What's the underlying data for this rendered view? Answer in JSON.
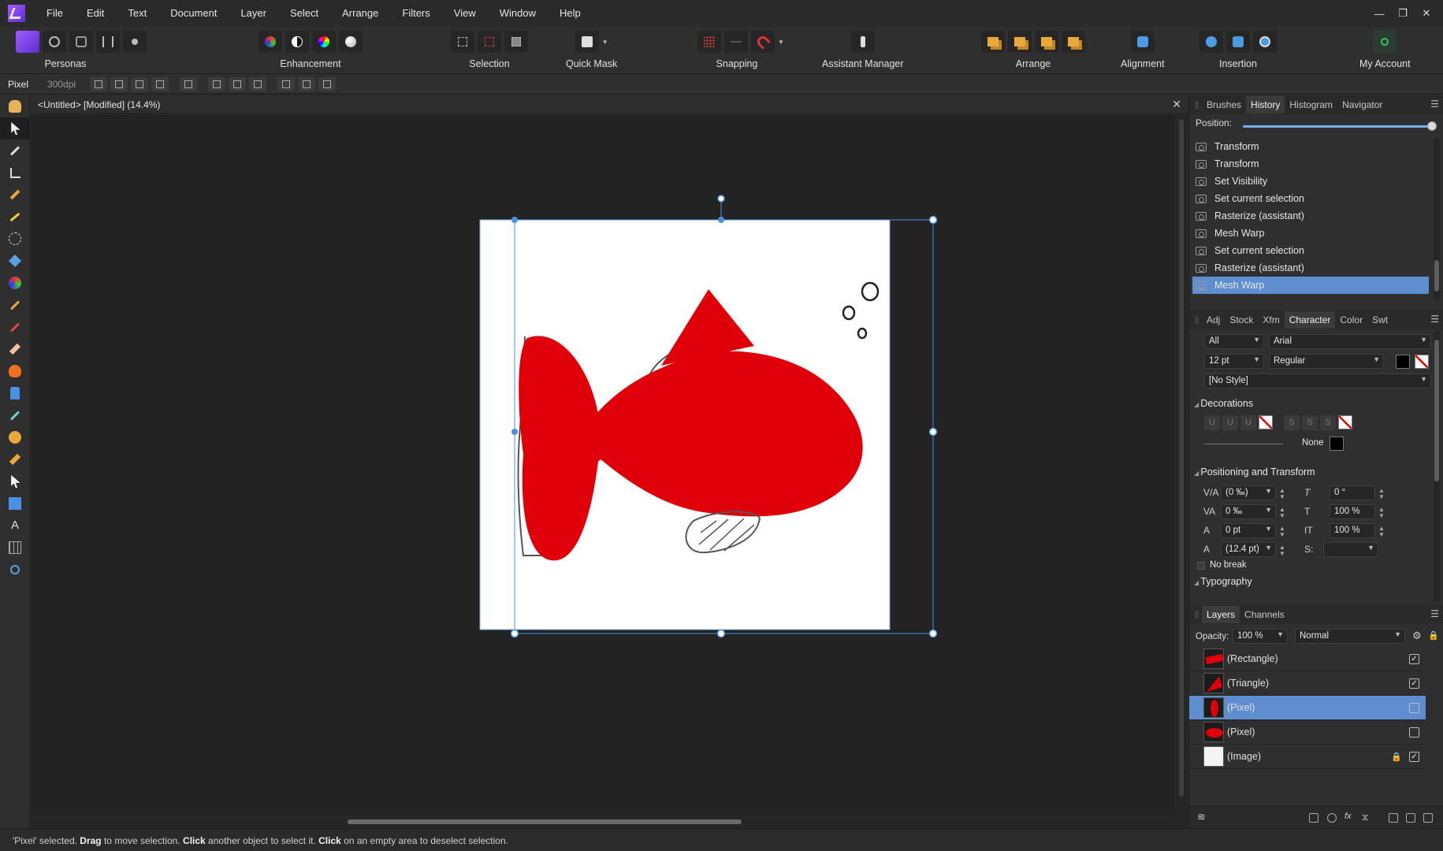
{
  "menubar": {
    "items": [
      "File",
      "Edit",
      "Text",
      "Document",
      "Layer",
      "Select",
      "Arrange",
      "Filters",
      "View",
      "Window",
      "Help"
    ],
    "window_controls": [
      "—",
      "❐",
      "✕"
    ]
  },
  "toolbar": {
    "personas_label": "Personas",
    "enhancement_label": "Enhancement",
    "selection_label": "Selection",
    "quickmask_label": "Quick Mask",
    "snapping_label": "Snapping",
    "assistant_label": "Assistant Manager",
    "arrange_label": "Arrange",
    "alignment_label": "Alignment",
    "insertion_label": "Insertion",
    "account_label": "My Account"
  },
  "context": {
    "persona": "Pixel",
    "dpi": "300dpi"
  },
  "document": {
    "title": "<Untitled> [Modified] (14.4%)",
    "close": "✕"
  },
  "history_panel": {
    "tabs": [
      "Brushes",
      "History",
      "Histogram",
      "Navigator"
    ],
    "active_tab": "History",
    "position_label": "Position:",
    "items": [
      "Transform",
      "Transform",
      "Set Visibility",
      "Set current selection",
      "Rasterize (assistant)",
      "Mesh Warp",
      "Set current selection",
      "Rasterize (assistant)",
      "Mesh Warp"
    ],
    "selected_index": 8
  },
  "character_panel": {
    "tabs": [
      "Adj",
      "Stock",
      "Xfm",
      "Character",
      "Color",
      "Swt"
    ],
    "active_tab": "Character",
    "scope": "All",
    "font_family": "Arial",
    "font_size": "12 pt",
    "font_style": "Regular",
    "style": "[No Style]",
    "decorations_label": "Decorations",
    "decoration_buttons": [
      "U",
      "U",
      "U",
      "S",
      "S",
      "S"
    ],
    "line_style": "None",
    "positioning_label": "Positioning and Transform",
    "fields": {
      "tracking": "(0 ‰)",
      "kerning": "0 ‰",
      "baseline": "0 pt",
      "leading": "(12.4 pt)",
      "shear": "0 °",
      "vscale": "100 %",
      "hscale": "100 %",
      "s_label": "S:",
      "s_value": ""
    },
    "no_break": "No break",
    "typography_label": "Typography"
  },
  "layers_panel": {
    "tabs": [
      "Layers",
      "Channels"
    ],
    "active_tab": "Layers",
    "opacity_label": "Opacity:",
    "opacity_value": "100 %",
    "blend_mode": "Normal",
    "layers": [
      {
        "name": "(Rectangle)",
        "checked": "✓",
        "locked": ""
      },
      {
        "name": "(Triangle)",
        "checked": "✓",
        "locked": ""
      },
      {
        "name": "(Pixel)",
        "checked": "",
        "locked": ""
      },
      {
        "name": "(Pixel)",
        "checked": "",
        "locked": ""
      },
      {
        "name": "(Image)",
        "checked": "✓",
        "locked": "🔒"
      }
    ],
    "selected_index": 2
  },
  "status": {
    "q1": "'Pixel' selected. ",
    "b1": "Drag",
    "t1": " to move selection. ",
    "b2": "Click",
    "t2": " another object to select it. ",
    "b3": "Click",
    "t3": " on an empty area to deselect selection."
  },
  "colors": {
    "accent": "#5f8ed0",
    "fish_red": "#e0000a",
    "handle_blue": "#4a90e2"
  }
}
